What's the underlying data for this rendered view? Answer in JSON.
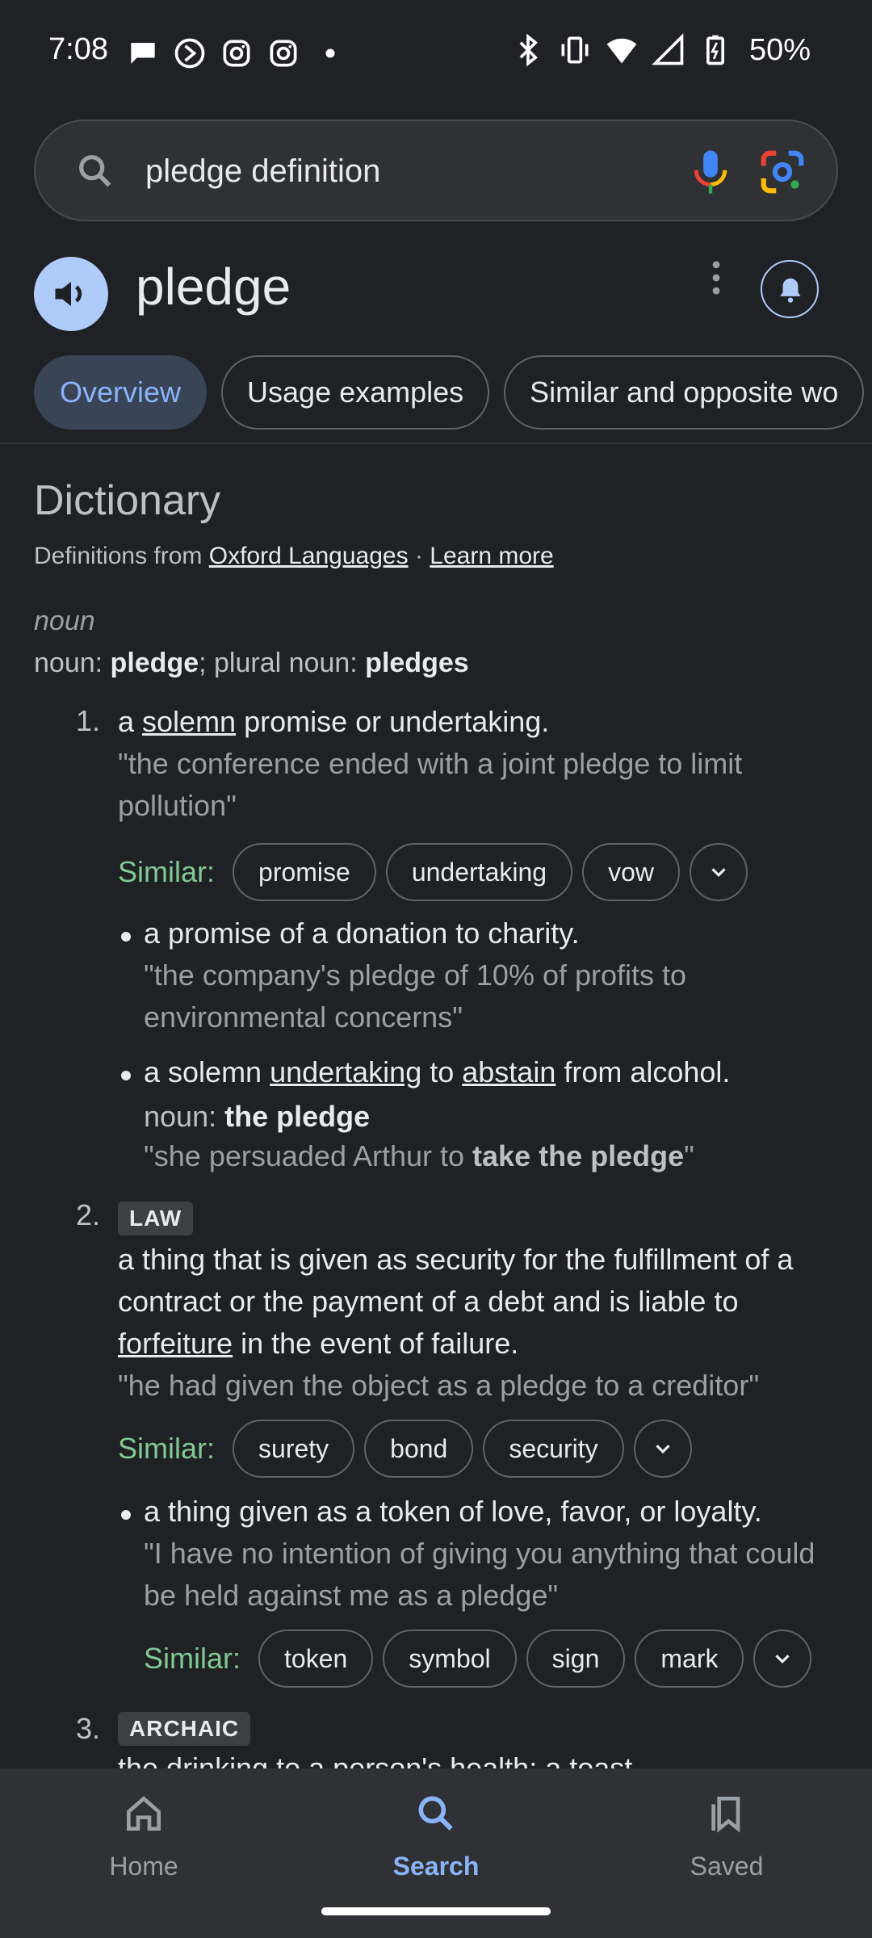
{
  "status_bar": {
    "time": "7:08",
    "battery": "50%",
    "left_icons": [
      "chat-bubble-icon",
      "forward-icon",
      "instagram-icon",
      "instagram-icon",
      "dot-icon"
    ],
    "right_icons": [
      "bluetooth-icon",
      "vibrate-icon",
      "wifi-icon",
      "signal-icon",
      "battery-icon"
    ]
  },
  "search": {
    "query": "pledge definition"
  },
  "header": {
    "word": "pledge"
  },
  "tabs": [
    {
      "label": "Overview",
      "active": true
    },
    {
      "label": "Usage examples",
      "active": false
    },
    {
      "label": "Similar and opposite wo",
      "active": false
    }
  ],
  "dictionary": {
    "heading": "Dictionary",
    "source_prefix": "Definitions from",
    "source_link": "Oxford Languages",
    "separator": "·",
    "learn_more": "Learn more",
    "part_of_speech": "noun",
    "forms": {
      "noun_label": "noun:",
      "noun": "pledge",
      "plural_label": "; plural noun:",
      "plural": "pledges"
    }
  },
  "senses": {
    "s1": {
      "number": "1.",
      "def_a": "a ",
      "def_link": "solemn",
      "def_b": " promise or undertaking.",
      "example": "\"the conference ended with a joint pledge to limit pollution\"",
      "similar_label": "Similar:",
      "similar": [
        "promise",
        "undertaking",
        "vow"
      ],
      "sub1": {
        "def": "a promise of a donation to charity.",
        "example": "\"the company's pledge of 10% of profits to environmental concerns\""
      },
      "sub2": {
        "def_a": "a solemn ",
        "def_link1": "undertaking",
        "def_b": " to ",
        "def_link2": "abstain",
        "def_c": " from alcohol.",
        "noun_label": "noun:",
        "noun": "the pledge",
        "example_a": "\"she persuaded Arthur to ",
        "example_b": "take the pledge",
        "example_c": "\""
      }
    },
    "s2": {
      "number": "2.",
      "label": "LAW",
      "def_a": "a thing that is given as security for the fulfillment of a contract or the payment of a debt and is liable to ",
      "def_link": "forfeiture",
      "def_b": " in the event of failure.",
      "example": "\"he had given the object as a pledge to a creditor\"",
      "similar_label": "Similar:",
      "similar": [
        "surety",
        "bond",
        "security"
      ],
      "sub1": {
        "def": "a thing given as a token of love, favor, or loyalty.",
        "example": "\"I have no intention of giving you anything that could be held against me as a pledge\"",
        "similar_label": "Similar:",
        "similar": [
          "token",
          "symbol",
          "sign",
          "mark"
        ]
      }
    },
    "s3": {
      "number": "3.",
      "label": "ARCHAIC",
      "def": "the drinking to a person's health; a toast."
    }
  },
  "bottom_nav": [
    {
      "label": "Home",
      "icon": "home-icon",
      "active": false
    },
    {
      "label": "Search",
      "icon": "search-icon",
      "active": true
    },
    {
      "label": "Saved",
      "icon": "bookmarks-icon",
      "active": false
    }
  ],
  "colors": {
    "background": "#202124",
    "accent": "#8ab4f8",
    "similar_label": "#81c995",
    "active_tab_bg": "#394457",
    "speaker_bg": "#aecbfa"
  }
}
